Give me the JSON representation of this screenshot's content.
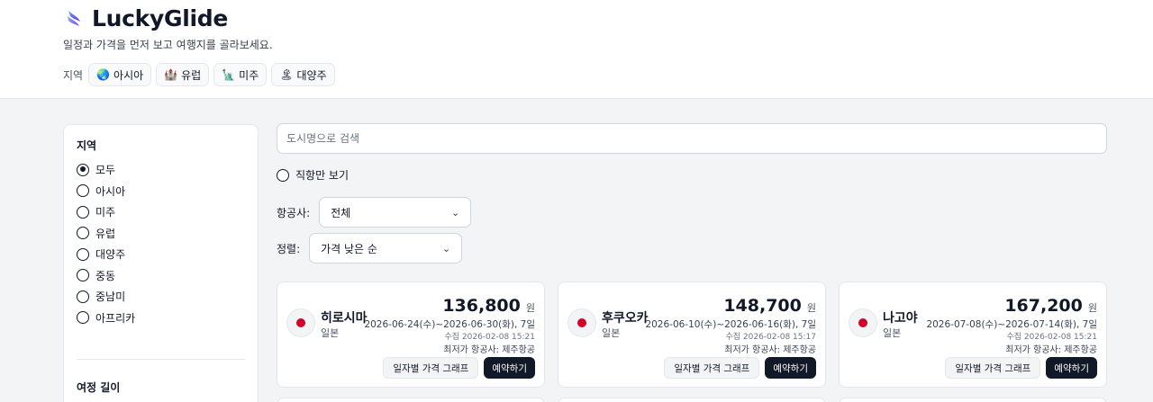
{
  "header": {
    "brand": "LuckyGlide",
    "tagline": "일정과 가격을 먼저 보고 여행지를 골라보세요.",
    "region_label": "지역",
    "regions": [
      {
        "label": "아시아",
        "icon": "🌏"
      },
      {
        "label": "유럽",
        "icon": "🏰"
      },
      {
        "label": "미주",
        "icon": "🗽"
      },
      {
        "label": "대양주",
        "icon": "🏝"
      }
    ]
  },
  "sidebar": {
    "region_title": "지역",
    "options": [
      "모두",
      "아시아",
      "미주",
      "유럽",
      "대양주",
      "중동",
      "중남미",
      "아프리카"
    ],
    "selected": "모두",
    "trip_length_title": "여정 길이"
  },
  "filters": {
    "search_placeholder": "도시명으로 검색",
    "direct_only": "직항만 보기",
    "airline_label": "항공사:",
    "airline_value": "전체",
    "sort_label": "정렬:",
    "sort_value": "가격 낮은 순"
  },
  "cards": [
    {
      "city": "히로시마",
      "country": "일본",
      "price": "136,800",
      "currency": "원",
      "dates": "2026-06-24(수)~2026-06-30(화), 7일",
      "collected": "수집 2026-02-08 15:21",
      "carrier": "최저가 항공사: 제주항공",
      "graph_label": "일자별 가격 그래프",
      "book_label": "예약하기"
    },
    {
      "city": "후쿠오카",
      "country": "일본",
      "price": "148,700",
      "currency": "원",
      "dates": "2026-06-10(수)~2026-06-16(화), 7일",
      "collected": "수집 2026-02-08 15:17",
      "carrier": "최저가 항공사: 제주항공",
      "graph_label": "일자별 가격 그래프",
      "book_label": "예약하기"
    },
    {
      "city": "나고야",
      "country": "일본",
      "price": "167,200",
      "currency": "원",
      "dates": "2026-07-08(수)~2026-07-14(화), 7일",
      "collected": "수집 2026-02-08 15:21",
      "carrier": "최저가 항공사: 제주항공",
      "graph_label": "일자별 가격 그래프",
      "book_label": "예약하기"
    }
  ]
}
